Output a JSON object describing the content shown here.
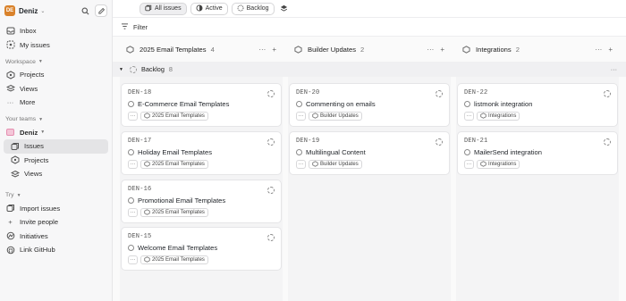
{
  "workspace": {
    "initials": "DE",
    "name": "Deniz"
  },
  "nav": {
    "inbox": "Inbox",
    "my_issues": "My issues",
    "workspace_label": "Workspace",
    "projects": "Projects",
    "views": "Views",
    "more": "More",
    "your_teams_label": "Your teams",
    "team_name": "Deniz",
    "team_issues": "Issues",
    "team_projects": "Projects",
    "team_views": "Views",
    "try_label": "Try",
    "import_issues": "Import issues",
    "invite_people": "Invite people",
    "initiatives": "Initiatives",
    "link_github": "Link GitHub"
  },
  "toolbar": {
    "all_issues": "All issues",
    "active": "Active",
    "backlog": "Backlog",
    "filter": "Filter"
  },
  "board": {
    "group": {
      "name": "Backlog",
      "count": "8"
    },
    "columns": [
      {
        "name": "2025 Email Templates",
        "count": "4",
        "cards": [
          {
            "id": "DEN-18",
            "title": "E-Commerce Email Templates",
            "tag": "2025 Email Templates"
          },
          {
            "id": "DEN-17",
            "title": "Holiday Email Templates",
            "tag": "2025 Email Templates"
          },
          {
            "id": "DEN-16",
            "title": "Promotional Email Templates",
            "tag": "2025 Email Templates"
          },
          {
            "id": "DEN-15",
            "title": "Welcome Email Templates",
            "tag": "2025 Email Templates"
          }
        ]
      },
      {
        "name": "Builder Updates",
        "count": "2",
        "cards": [
          {
            "id": "DEN-20",
            "title": "Commenting on emails",
            "tag": "Builder Updates"
          },
          {
            "id": "DEN-19",
            "title": "Multilingual Content",
            "tag": "Builder Updates"
          }
        ]
      },
      {
        "name": "Integrations",
        "count": "2",
        "cards": [
          {
            "id": "DEN-22",
            "title": "listmonk integration",
            "tag": "Integrations"
          },
          {
            "id": "DEN-21",
            "title": "MailerSend integration",
            "tag": "Integrations"
          }
        ]
      }
    ]
  },
  "colors": {
    "sidebar_bg": "#f7f7f8",
    "board_bg": "#fafafa",
    "avatar": "#d9822b",
    "active_item": "#e4e4e6"
  }
}
